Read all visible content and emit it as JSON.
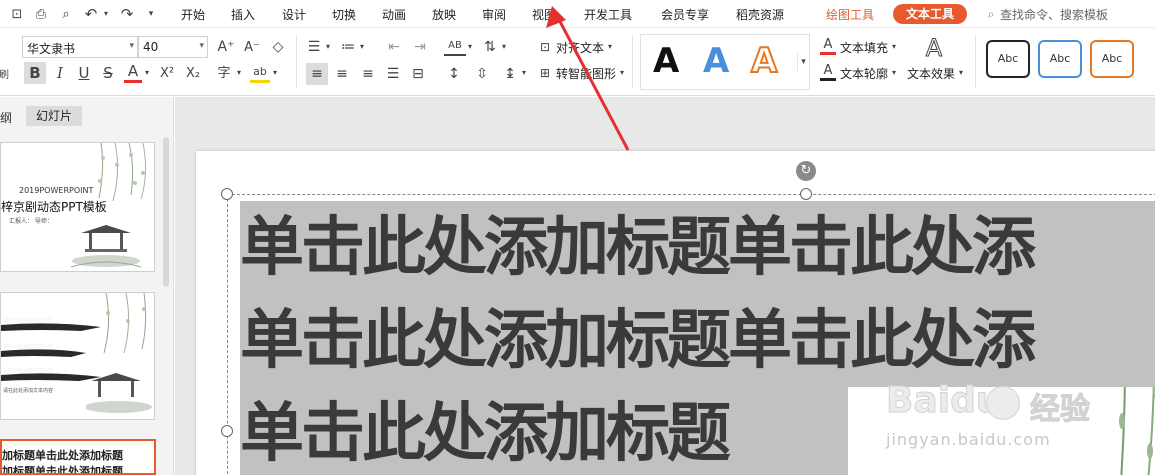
{
  "menu": {
    "tabs": [
      "开始",
      "插入",
      "设计",
      "切换",
      "动画",
      "放映",
      "审阅",
      "视图",
      "开发工具",
      "会员专享",
      "稻壳资源"
    ],
    "context_tab_1": "绘图工具",
    "context_tab_2": "文本工具",
    "search_placeholder": "查找命令、搜索模板"
  },
  "toolbar": {
    "font_name": "华文隶书",
    "font_size": "40",
    "align_text_label": "对齐文本",
    "smartart_label": "转智能图形",
    "text_fill_label": "文本填充",
    "text_outline_label": "文本轮廓",
    "text_effect_label": "文本效果",
    "style_big_A": "A",
    "shape_style_label": "Abc",
    "font_grow_icon": "A⁺",
    "font_shrink_icon": "A⁻",
    "bold_icon": "B",
    "italic_icon": "I",
    "underline_icon": "U",
    "strike_icon": "S",
    "font_color_icon": "A",
    "superscript_icon": "X²",
    "subscript_icon": "X₂",
    "pinyin_icon": "字",
    "highlight_icon": "ab",
    "big_A_icon": "A",
    "text_fill_icon": "A",
    "text_outline_icon": "A"
  },
  "colors": {
    "accent": "#e8592e",
    "toolbar_bg": "#ffffff",
    "workspace_bg": "#e8e8e8",
    "selection_gray": "#c1c1c1",
    "slide_text": "#3a3a3a",
    "arrow_red": "#e53030",
    "style_blue": "#4a90d9",
    "style_orange": "#e87722"
  },
  "icons": [
    "save-icon",
    "print-icon",
    "print-preview-icon",
    "undo-icon",
    "redo-icon",
    "customize-icon",
    "search-icon",
    "clear-format-icon",
    "bullets-icon",
    "numbering-icon",
    "indent-icon",
    "text-direction-icon",
    "line-spacing-icon",
    "align-left-icon",
    "align-center-icon",
    "align-right-icon",
    "justify-icon",
    "distribute-icon",
    "rotate-handle-icon"
  ],
  "left_panel": {
    "tab_outline": "纲",
    "tab_slides": "幻灯片",
    "thumb1_small": "2019POWERPOINT",
    "thumb1_title": "梓京剧动态PPT模板",
    "thumb1_sub": "汇报人： 导师：",
    "thumb2_line": "请在此处添加文本内容",
    "thumb3_line1": "加标题单击此处添加标题",
    "thumb3_line2": "加标题单击此处添加标题"
  },
  "slide": {
    "line1": "单击此处添加标题单击此处添",
    "line2": "单击此处添加标题单击此处添",
    "line3": "单击此处添加标题"
  },
  "watermark": {
    "brand": "Baidu",
    "brand_cn": "经验",
    "url": "jingyan.baidu.com"
  }
}
